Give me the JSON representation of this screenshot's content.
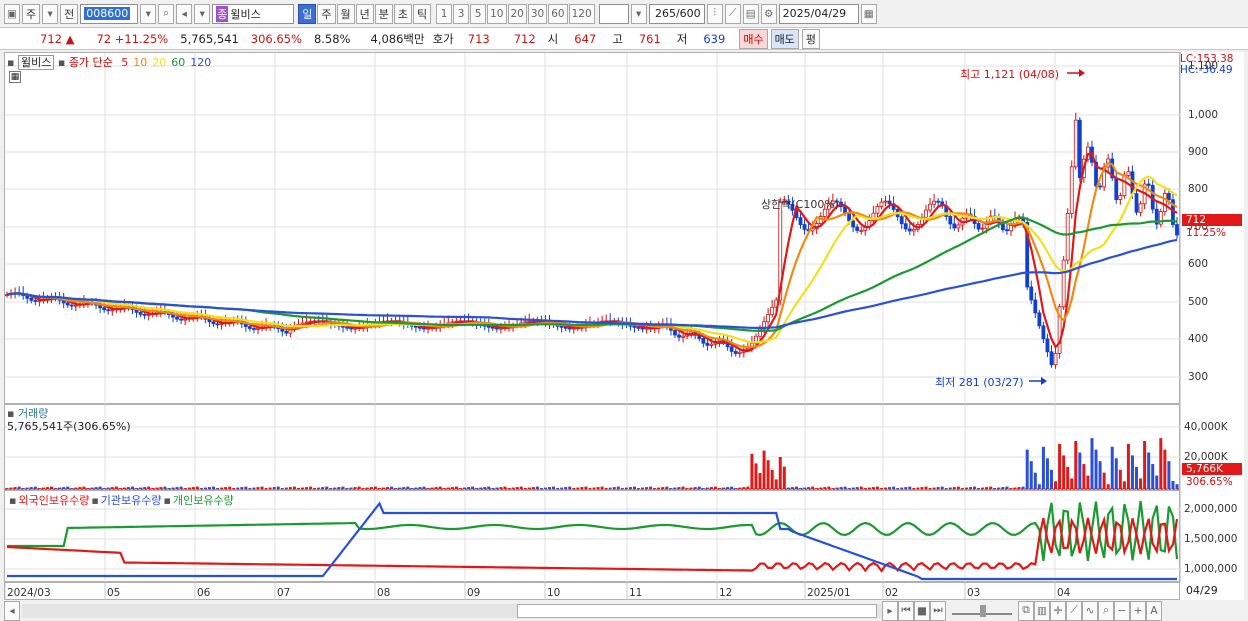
{
  "toolbar": {
    "period_label": "주",
    "prev_label": "전",
    "stock_code": "008600",
    "stock_name": "윌비스",
    "stock_tag": "종",
    "periods": [
      "일",
      "주",
      "월",
      "년",
      "분",
      "초",
      "틱"
    ],
    "active_period": "일",
    "intervals": [
      "1",
      "3",
      "5",
      "10",
      "20",
      "30",
      "60",
      "120"
    ],
    "count": "265",
    "count_total": "/600",
    "date": "2025/04/29"
  },
  "quote": {
    "price": "712",
    "change": "72",
    "change_pct": "+11.25%",
    "volume": "5,765,541",
    "volume_ratio": "306.65%",
    "turnover": "8.58%",
    "amount": "4,086백만",
    "bid_label": "호가",
    "ask": "713",
    "bid": "712",
    "open_label": "시",
    "open": "647",
    "high_label": "고",
    "high": "761",
    "low_label": "저",
    "low": "639",
    "buy_label": "매수",
    "sell_label": "매도",
    "eval_label": "평"
  },
  "price_panel": {
    "legend_name": "윌비스",
    "legend_ma": "종가 단순",
    "ma_periods": [
      "5",
      "10",
      "20",
      "60",
      "120"
    ],
    "ma_colors": [
      "#e01818",
      "#f08a10",
      "#f2e020",
      "#1a9a30",
      "#2a50d8"
    ],
    "lc": "LC:153.38",
    "hc": "HC:-36.49",
    "max_note": "최고 1,121 (04/08)",
    "min_note": "최저 281 (03/27)",
    "limit_note": "상한락(C100%)",
    "price_tag": "712",
    "pct_tag": "11.25%",
    "y_ticks": [
      "1,100",
      "1,000",
      "900",
      "800",
      "700",
      "600",
      "500",
      "400",
      "300"
    ]
  },
  "volume_panel": {
    "title": "거래량",
    "value": "5,765,541주(306.65%)",
    "y_ticks": [
      "40,000K",
      "20,000K"
    ],
    "value_tag": "5,766K",
    "pct_tag": "306.65%"
  },
  "holdings_panel": {
    "series_labels": [
      "외국인보유수량",
      "기관보유수량",
      "개인보유수량"
    ],
    "series_colors": [
      "#e01818",
      "#2a50d8",
      "#1a9a30"
    ],
    "y_ticks": [
      "2,000,000",
      "1,500,000",
      "1,000,000"
    ]
  },
  "x_axis": {
    "labels": [
      "2024/03",
      "05",
      "06",
      "07",
      "08",
      "09",
      "10",
      "11",
      "12",
      "2025/01",
      "02",
      "03",
      "04"
    ],
    "right_label": "04/29"
  }
}
